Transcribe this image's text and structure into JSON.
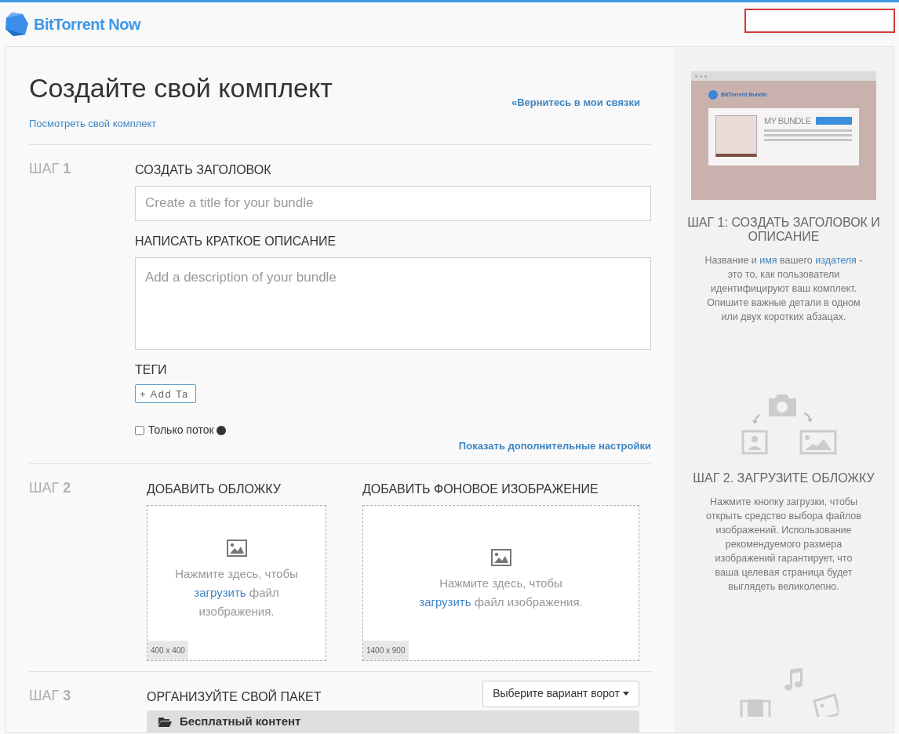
{
  "header": {
    "logo_text": "BitTorrent Now",
    "field": {
      "error": true
    }
  },
  "page": {
    "title": "Создайте свой комплект",
    "back_link": "«Вернитесь в мои связки",
    "view_link": "Посмотреть свой комплект"
  },
  "step1": {
    "step": "ШАГ",
    "number": "1",
    "title_label": "СОЗДАТЬ ЗАГОЛОВОК",
    "title_placeholder": "Create a title for your bundle",
    "description_label": "НАПИСАТЬ КРАТКОЕ ОПИСАНИЕ",
    "description_placeholder": "Add a description of your bundle",
    "tags_label": "ТЕГИ",
    "tag_placeholder": "+ Add Ta",
    "stream_only": {
      "label": "Только поток",
      "checked": false
    },
    "advanced_link": "Показать дополнительные настройки"
  },
  "step2": {
    "step": "ШАГ",
    "number": "2",
    "uploads": [
      {
        "label": "ДОБАВИТЬ ОБЛОЖКУ",
        "before": "Нажмите здесь, чтобы",
        "link": "загрузить",
        "after": "файл изображения.",
        "size": "400 x 400"
      },
      {
        "label": "ДОБАВИТЬ ФОНОВОЕ ИЗОБРАЖЕНИЕ",
        "before": "Нажмите здесь, чтобы",
        "link": "загрузить",
        "after": "файл изображения.",
        "size": "1400 x 900"
      }
    ]
  },
  "step3": {
    "step": "ШАГ",
    "number": "3",
    "label": "ОРГАНИЗУЙТЕ СВОЙ ПАКЕТ",
    "gate_button": "Выберите вариант ворот",
    "folder": "Бесплатный контент"
  },
  "sidebar": [
    {
      "kind": "preview",
      "mock": {
        "brand": "BitTorrent Bundle",
        "title": "MY BUNDLE"
      },
      "heading": "ШАГ 1: СОЗДАТЬ ЗАГОЛОВОК И ОПИСАНИЕ",
      "text": [
        {
          "text": "Название и ",
          "link": false
        },
        {
          "text": "имя",
          "link": true
        },
        {
          "text": " вашего ",
          "link": false
        },
        {
          "text": "издателя",
          "link": true
        },
        {
          "text": " - это то, как пользователи идентифицируют ваш комплект. Опишите важные детали в одном или двух коротких абзацах.",
          "link": false
        }
      ]
    },
    {
      "kind": "upload",
      "heading": "ШАГ 2. ЗАГРУЗИТЕ ОБЛОЖКУ",
      "text": [
        {
          "text": "Нажмите кнопку загрузки, чтобы открыть средство выбора файлов изображений. Использование рекомендуемого размера изображений гарантирует, что ваша целевая страница будет выглядеть великолепно.",
          "link": false
        }
      ]
    },
    {
      "kind": "media"
    }
  ]
}
